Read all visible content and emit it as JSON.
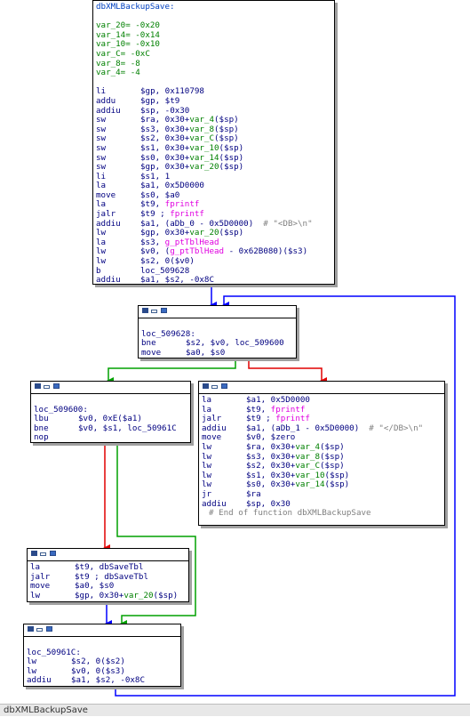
{
  "function_name": "dbXMLBackupSave",
  "status_bar": "dbXMLBackupSave",
  "edge_colors": {
    "true": "#00a000",
    "false": "#e00000",
    "uncond": "#0000ff"
  },
  "nodes": {
    "entry": {
      "lines": [
        {
          "t": "title",
          "text": "dbXMLBackupSave:"
        },
        {
          "t": "blank"
        },
        {
          "t": "var",
          "text": "var_20= -0x20"
        },
        {
          "t": "var",
          "text": "var_14= -0x14"
        },
        {
          "t": "var",
          "text": "var_10= -0x10"
        },
        {
          "t": "var",
          "text": "var_C= -0xC"
        },
        {
          "t": "var",
          "text": "var_8= -8"
        },
        {
          "t": "var",
          "text": "var_4= -4"
        },
        {
          "t": "blank"
        },
        {
          "t": "ins",
          "m": "li",
          "o": "$gp, 0x110798"
        },
        {
          "t": "ins",
          "m": "addu",
          "o": "$gp, $t9"
        },
        {
          "t": "ins",
          "m": "addiu",
          "o": "$sp, -0x30"
        },
        {
          "t": "ins",
          "m": "sw",
          "o": "$ra, 0x30+var_4($sp)"
        },
        {
          "t": "ins",
          "m": "sw",
          "o": "$s3, 0x30+var_8($sp)"
        },
        {
          "t": "ins",
          "m": "sw",
          "o": "$s2, 0x30+var_C($sp)"
        },
        {
          "t": "ins",
          "m": "sw",
          "o": "$s1, 0x30+var_10($sp)"
        },
        {
          "t": "ins",
          "m": "sw",
          "o": "$s0, 0x30+var_14($sp)"
        },
        {
          "t": "ins",
          "m": "sw",
          "o": "$gp, 0x30+var_20($sp)"
        },
        {
          "t": "ins",
          "m": "li",
          "o": "$s1, 1"
        },
        {
          "t": "ins",
          "m": "la",
          "o": "$a1, 0x5D0000"
        },
        {
          "t": "ins",
          "m": "move",
          "o": "$s0, $a0"
        },
        {
          "t": "ins",
          "m": "la",
          "o": "$t9, fprintf"
        },
        {
          "t": "ins",
          "m": "jalr",
          "o": "$t9 ; fprintf"
        },
        {
          "t": "ins",
          "m": "addiu",
          "o": "$a1, (aDb_0 - 0x5D0000)  # \"<DB>\\n\""
        },
        {
          "t": "ins",
          "m": "lw",
          "o": "$gp, 0x30+var_20($sp)"
        },
        {
          "t": "ins",
          "m": "la",
          "o": "$s3, g_ptTblHead"
        },
        {
          "t": "ins",
          "m": "lw",
          "o": "$v0, (g_ptTblHead - 0x62B080)($s3)"
        },
        {
          "t": "ins",
          "m": "lw",
          "o": "$s2, 0($v0)"
        },
        {
          "t": "ins",
          "m": "b",
          "o": "loc_509628"
        },
        {
          "t": "ins",
          "m": "addiu",
          "o": "$a1, $s2, -0x8C"
        }
      ]
    },
    "loop": {
      "lines": [
        {
          "t": "blank"
        },
        {
          "t": "label",
          "text": "loc_509628:"
        },
        {
          "t": "ins",
          "m": "bne",
          "o": "$s2, $v0, loc_509600"
        },
        {
          "t": "ins",
          "m": "move",
          "o": "$a0, $s0"
        }
      ]
    },
    "check": {
      "lines": [
        {
          "t": "blank"
        },
        {
          "t": "label",
          "text": "loc_509600:"
        },
        {
          "t": "ins",
          "m": "lbu",
          "o": "$v0, 0xE($a1)"
        },
        {
          "t": "ins",
          "m": "bne",
          "o": "$v0, $s1, loc_50961C"
        },
        {
          "t": "ins",
          "m": "nop",
          "o": ""
        }
      ]
    },
    "exit": {
      "lines": [
        {
          "t": "ins",
          "m": "la",
          "o": "$a1, 0x5D0000"
        },
        {
          "t": "ins",
          "m": "la",
          "o": "$t9, fprintf"
        },
        {
          "t": "ins",
          "m": "jalr",
          "o": "$t9 ; fprintf"
        },
        {
          "t": "ins",
          "m": "addiu",
          "o": "$a1, (aDb_1 - 0x5D0000)  # \"</DB>\\n\""
        },
        {
          "t": "ins",
          "m": "move",
          "o": "$v0, $zero"
        },
        {
          "t": "ins",
          "m": "lw",
          "o": "$ra, 0x30+var_4($sp)"
        },
        {
          "t": "ins",
          "m": "lw",
          "o": "$s3, 0x30+var_8($sp)"
        },
        {
          "t": "ins",
          "m": "lw",
          "o": "$s2, 0x30+var_C($sp)"
        },
        {
          "t": "ins",
          "m": "lw",
          "o": "$s1, 0x30+var_10($sp)"
        },
        {
          "t": "ins",
          "m": "lw",
          "o": "$s0, 0x30+var_14($sp)"
        },
        {
          "t": "ins",
          "m": "jr",
          "o": "$ra"
        },
        {
          "t": "ins",
          "m": "addiu",
          "o": "$sp, 0x30"
        },
        {
          "t": "comment",
          "text": "# End of function dbXMLBackupSave"
        }
      ]
    },
    "save": {
      "lines": [
        {
          "t": "ins",
          "m": "la",
          "o": "$t9, dbSaveTbl"
        },
        {
          "t": "ins",
          "m": "jalr",
          "o": "$t9 ; dbSaveTbl"
        },
        {
          "t": "ins",
          "m": "move",
          "o": "$a0, $s0"
        },
        {
          "t": "ins",
          "m": "lw",
          "o": "$gp, 0x30+var_20($sp)"
        }
      ]
    },
    "next": {
      "lines": [
        {
          "t": "blank"
        },
        {
          "t": "label",
          "text": "loc_50961C:"
        },
        {
          "t": "ins",
          "m": "lw",
          "o": "$s2, 0($s2)"
        },
        {
          "t": "ins",
          "m": "lw",
          "o": "$v0, 0($s3)"
        },
        {
          "t": "ins",
          "m": "addiu",
          "o": "$a1, $s2, -0x8C"
        }
      ]
    }
  }
}
